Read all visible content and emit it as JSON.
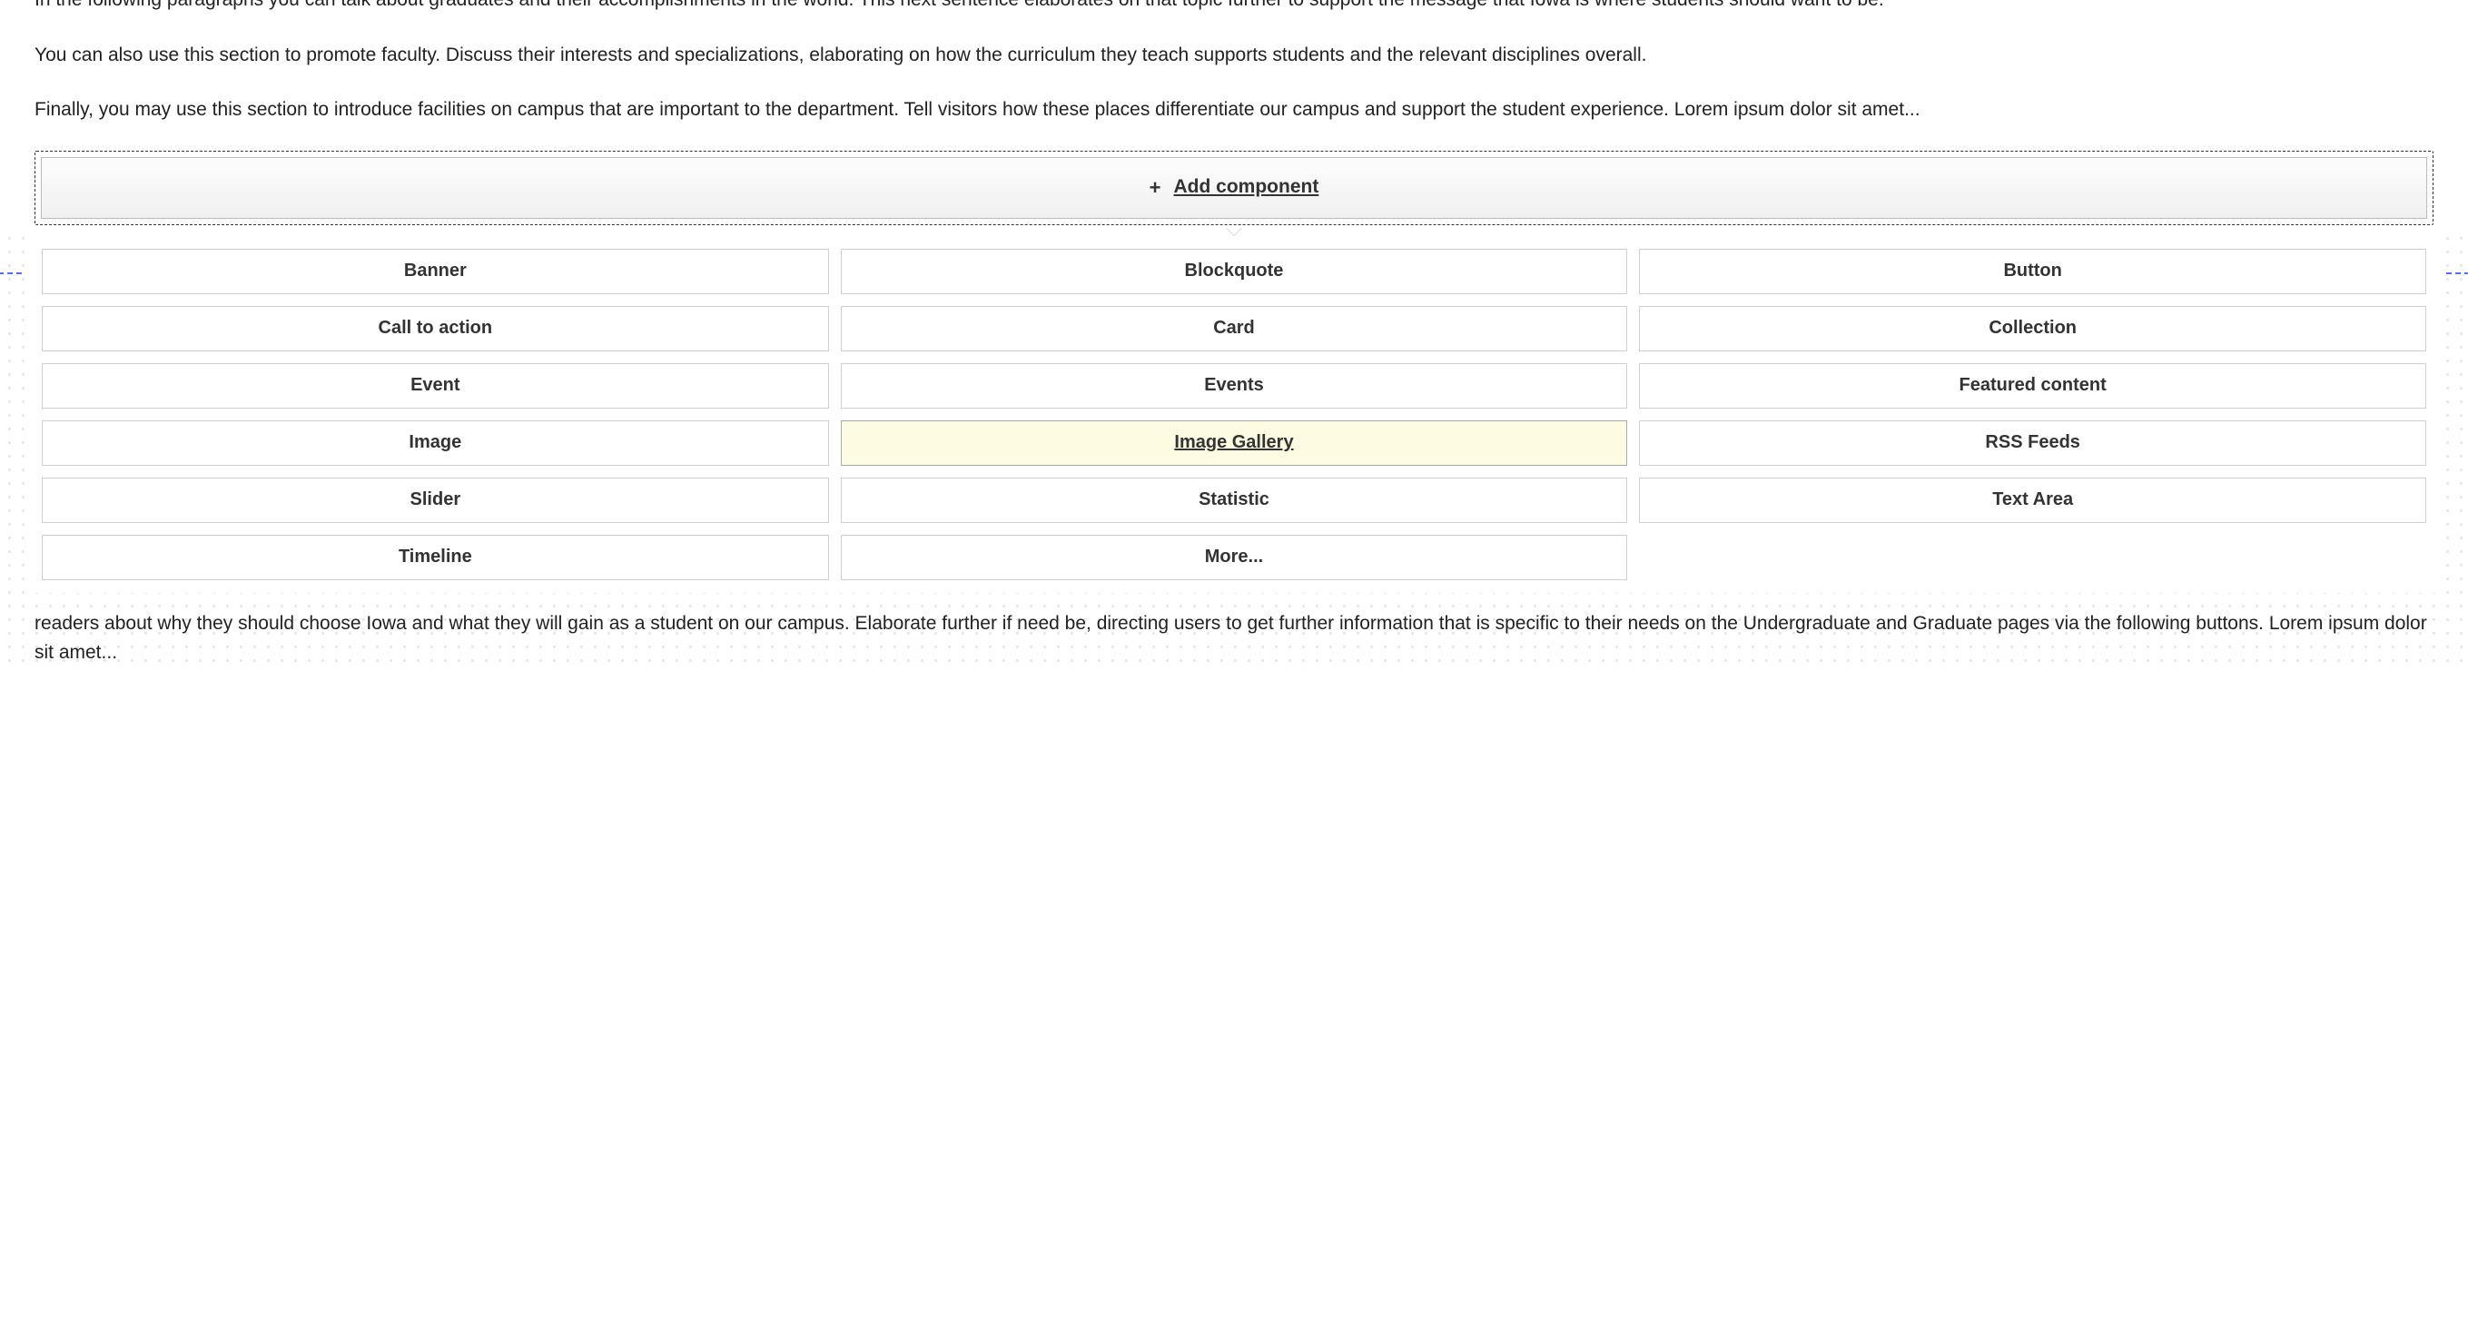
{
  "content": {
    "paragraph1": "In the following paragraphs you can talk about graduates and their accomplishments in the world. This next sentence elaborates on that topic further to support the message that Iowa is where students should want to be.",
    "paragraph2": "You can also use this section to promote faculty. Discuss their interests and specializations, elaborating on how the curriculum they teach supports students and the relevant disciplines overall.",
    "paragraph3": "Finally, you may use this section to introduce facilities on campus that are important to the department. Tell visitors how these places differentiate our campus and support the student experience. Lorem ipsum dolor sit amet...",
    "paragraph4": "readers about why they should choose Iowa and what they will gain as a student on our campus. Elaborate further if need be, directing users to get further information that is specific to their needs on the Undergraduate and Graduate pages via the following buttons. Lorem ipsum dolor sit amet..."
  },
  "add_component": {
    "plus": "+",
    "label": "Add component"
  },
  "components": [
    {
      "label": "Banner",
      "highlighted": false
    },
    {
      "label": "Blockquote",
      "highlighted": false
    },
    {
      "label": "Button",
      "highlighted": false
    },
    {
      "label": "Call to action",
      "highlighted": false
    },
    {
      "label": "Card",
      "highlighted": false
    },
    {
      "label": "Collection",
      "highlighted": false
    },
    {
      "label": "Event",
      "highlighted": false
    },
    {
      "label": "Events",
      "highlighted": false
    },
    {
      "label": "Featured content",
      "highlighted": false
    },
    {
      "label": "Image",
      "highlighted": false
    },
    {
      "label": "Image Gallery",
      "highlighted": true
    },
    {
      "label": "RSS Feeds",
      "highlighted": false
    },
    {
      "label": "Slider",
      "highlighted": false
    },
    {
      "label": "Statistic",
      "highlighted": false
    },
    {
      "label": "Text Area",
      "highlighted": false
    },
    {
      "label": "Timeline",
      "highlighted": false
    },
    {
      "label": "More...",
      "highlighted": false
    }
  ]
}
